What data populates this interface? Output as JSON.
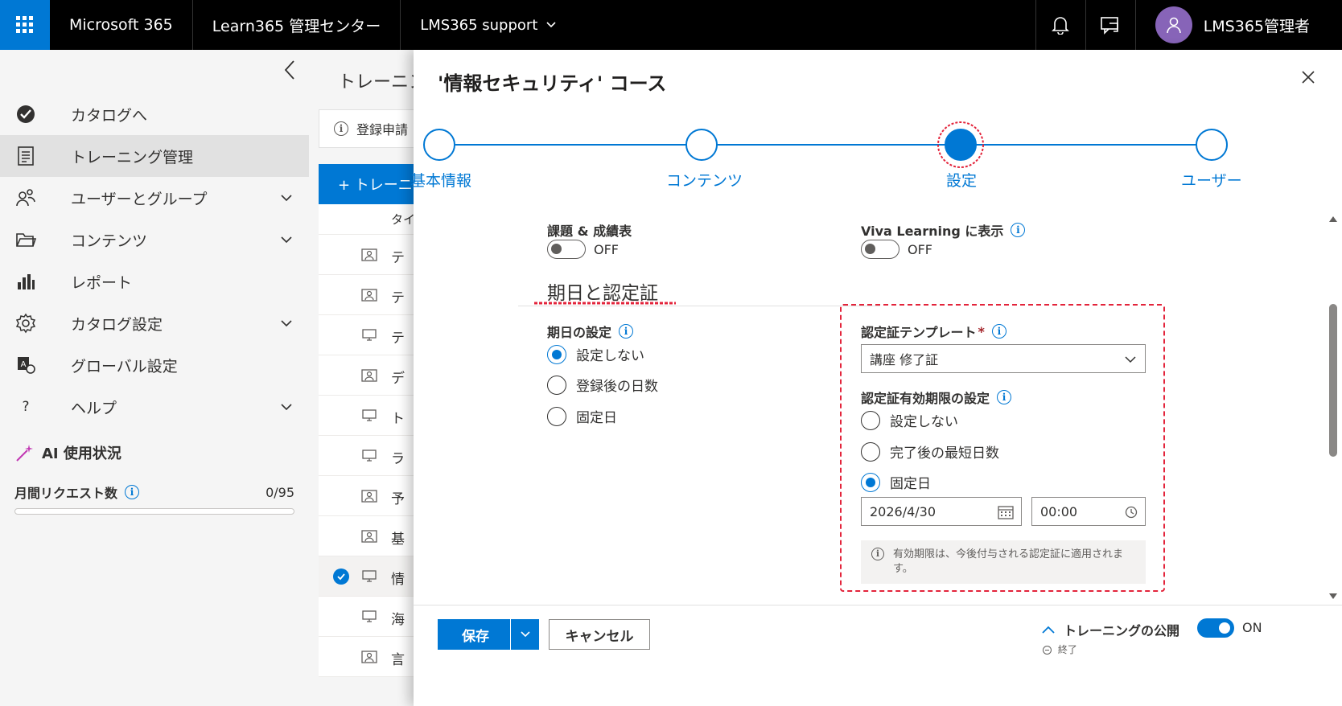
{
  "topbar": {
    "app_name": "Microsoft 365",
    "admin_center": "Learn365 管理センター",
    "tenant": "LMS365 support",
    "user_name": "LMS365管理者"
  },
  "sidebar": {
    "items": [
      {
        "label": "カタログへ",
        "icon": "catalog-icon"
      },
      {
        "label": "トレーニング管理",
        "icon": "training-icon"
      },
      {
        "label": "ユーザーとグループ",
        "icon": "users-icon"
      },
      {
        "label": "コンテンツ",
        "icon": "folder-icon"
      },
      {
        "label": "レポート",
        "icon": "chart-icon"
      },
      {
        "label": "カタログ設定",
        "icon": "gear-icon"
      },
      {
        "label": "グローバル設定",
        "icon": "global-settings-icon"
      },
      {
        "label": "ヘルプ",
        "icon": "help-icon"
      }
    ],
    "ai_usage": {
      "title": "AI 使用状況",
      "monthly_requests_label": "月間リクエスト数",
      "monthly_requests_value": "0/95",
      "progress": 0
    }
  },
  "middle": {
    "title": "トレーニング",
    "notice": "登録申請",
    "add_button": "+ トレーニング",
    "column_header": "タイ",
    "rows": [
      "テ",
      "テ",
      "テ",
      "デ",
      "ト",
      "ラ",
      "予",
      "基",
      "情",
      "海",
      "言"
    ]
  },
  "panel": {
    "title": "'情報セキュリティ' コース",
    "steps": [
      "基本情報",
      "コンテンツ",
      "設定",
      "ユーザー"
    ],
    "active_step": 2,
    "assignments": {
      "label": "課題 & 成績表",
      "state": "OFF"
    },
    "viva": {
      "label": "Viva Learning に表示",
      "state": "OFF"
    },
    "section_title": "期日と認定証",
    "due_date": {
      "label": "期日の設定",
      "options": [
        "設定しない",
        "登録後の日数",
        "固定日"
      ],
      "selected": 0
    },
    "certificate": {
      "label": "認定証テンプレート",
      "required_mark": "*",
      "value": "講座 修了証"
    },
    "expiry": {
      "label": "認定証有効期限の設定",
      "options": [
        "設定しない",
        "完了後の最短日数",
        "固定日"
      ],
      "selected": 2,
      "date": "2026/4/30",
      "time": "00:00",
      "notice": "有効期限は、今後付与される認定証に適用されます。"
    },
    "footer": {
      "save": "保存",
      "cancel": "キャンセル",
      "publish_label": "トレーニングの公開",
      "publish_sub": "終了",
      "publish_state": "ON"
    }
  },
  "colors": {
    "accent": "#0078d4",
    "highlight": "#e3243b",
    "avatar": "#8764b8"
  }
}
